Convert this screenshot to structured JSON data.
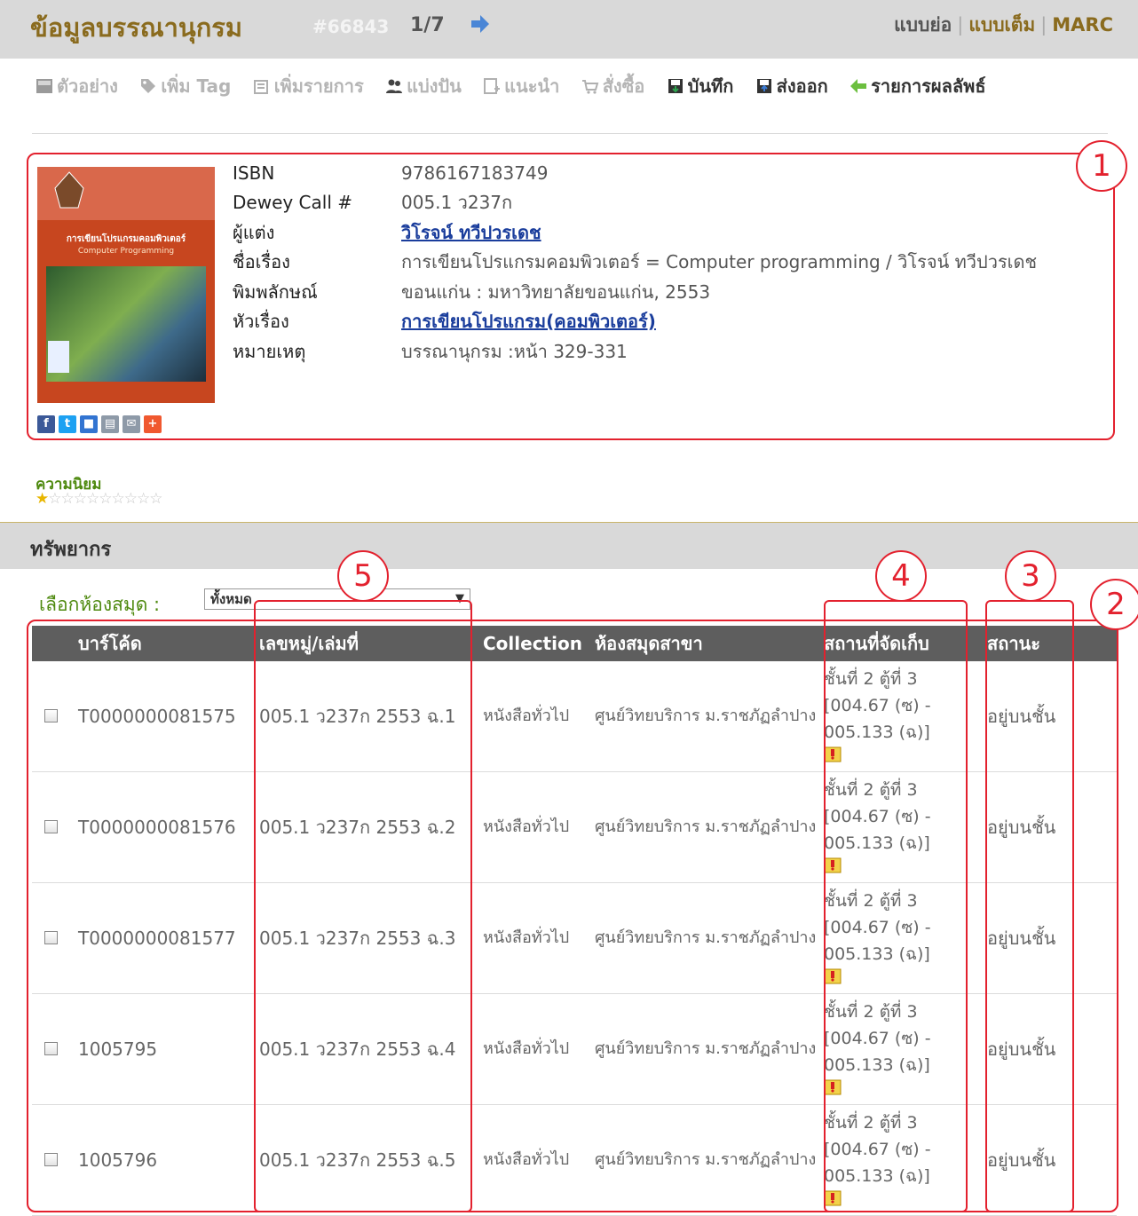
{
  "header": {
    "title": "ข้อมูลบรรณานุกรม",
    "record_id": "#66843",
    "pager": "1/7",
    "views": [
      "แบบย่อ",
      "แบบเต็ม",
      "MARC"
    ]
  },
  "toolbar": {
    "items": [
      {
        "label": "ตัวอย่าง",
        "icon": "preview-icon",
        "enabled": false
      },
      {
        "label": "เพิ่ม Tag",
        "icon": "tag-icon",
        "enabled": false
      },
      {
        "label": "เพิ่มรายการ",
        "icon": "add-list-icon",
        "enabled": false
      },
      {
        "label": "แบ่งปัน",
        "icon": "share-people-icon",
        "enabled": false
      },
      {
        "label": "แนะนำ",
        "icon": "recommend-icon",
        "enabled": false
      },
      {
        "label": "สั่งซื้อ",
        "icon": "cart-icon",
        "enabled": false
      },
      {
        "label": "บันทึก",
        "icon": "save-icon",
        "enabled": true
      },
      {
        "label": "ส่งออก",
        "icon": "export-icon",
        "enabled": true
      },
      {
        "label": "รายการผลลัพธ์",
        "icon": "back-arrow-icon",
        "enabled": true
      }
    ]
  },
  "record": {
    "fields": [
      {
        "label": "ISBN",
        "value": "9786167183749",
        "link": false
      },
      {
        "label": "Dewey Call #",
        "value": "005.1 ว237ก",
        "link": false
      },
      {
        "label": "ผู้แต่ง",
        "value": "วิโรจน์ ทวีปวรเดช",
        "link": true
      },
      {
        "label": "ชื่อเรื่อง",
        "value": "การเขียนโปรแกรมคอมพิวเตอร์ = Computer programming / วิโรจน์ ทวีปวรเดช",
        "link": false
      },
      {
        "label": "พิมพลักษณ์",
        "value": "ขอนแก่น : มหาวิทยาลัยขอนแก่น, 2553",
        "link": false
      },
      {
        "label": "หัวเรื่อง",
        "value": "การเขียนโปรแกรม(คอมพิวเตอร์)",
        "link": true
      },
      {
        "label": "หมายเหตุ",
        "value": "บรรณานุกรม :หน้า 329-331",
        "link": false
      }
    ],
    "cover_title_th": "การเขียนโปรแกรมคอมพิวเตอร์",
    "cover_title_en": "Computer Programming",
    "share_icons": [
      {
        "name": "facebook-icon",
        "glyph": "f",
        "color": "#3b5998"
      },
      {
        "name": "twitter-icon",
        "glyph": "t",
        "color": "#1da1f2"
      },
      {
        "name": "delicious-icon",
        "glyph": "■",
        "color": "#3274d1"
      },
      {
        "name": "print-icon",
        "glyph": "▤",
        "color": "#8e9aa8"
      },
      {
        "name": "email-icon",
        "glyph": "✉",
        "color": "#8e9aa8"
      },
      {
        "name": "more-share-icon",
        "glyph": "+",
        "color": "#f0582f"
      }
    ]
  },
  "popularity": {
    "label": "ความนิยม",
    "rating": 1,
    "max": 10
  },
  "resources": {
    "title": "ทรัพยากร",
    "library_label": "เลือกห้องสมุด :",
    "library_selected": "ทั้งหมด",
    "columns": [
      "บาร์โค้ด",
      "เลขหมู่/เล่มที่",
      "Collection",
      "ห้องสมุดสาขา",
      "สถานที่จัดเก็บ",
      "สถานะ"
    ],
    "rows": [
      {
        "barcode": "T0000000081575",
        "call_no": "005.1 ว237ก 2553 ฉ.1",
        "collection": "หนังสือทั่วไป",
        "branch": "ศูนย์วิทยบริการ ม.ราชภัฏลำปาง",
        "location": [
          "ชั้นที่ 2 ตู้ที่ 3",
          "[004.67 (ซ) -",
          "005.133 (ฉ)]"
        ],
        "status": "อยู่บนชั้น"
      },
      {
        "barcode": "T0000000081576",
        "call_no": "005.1 ว237ก 2553 ฉ.2",
        "collection": "หนังสือทั่วไป",
        "branch": "ศูนย์วิทยบริการ ม.ราชภัฏลำปาง",
        "location": [
          "ชั้นที่ 2 ตู้ที่ 3",
          "[004.67 (ซ) -",
          "005.133 (ฉ)]"
        ],
        "status": "อยู่บนชั้น"
      },
      {
        "barcode": "T0000000081577",
        "call_no": "005.1 ว237ก 2553 ฉ.3",
        "collection": "หนังสือทั่วไป",
        "branch": "ศูนย์วิทยบริการ ม.ราชภัฏลำปาง",
        "location": [
          "ชั้นที่ 2 ตู้ที่ 3",
          "[004.67 (ซ) -",
          "005.133 (ฉ)]"
        ],
        "status": "อยู่บนชั้น"
      },
      {
        "barcode": "1005795",
        "call_no": "005.1 ว237ก 2553 ฉ.4",
        "collection": "หนังสือทั่วไป",
        "branch": "ศูนย์วิทยบริการ ม.ราชภัฏลำปาง",
        "location": [
          "ชั้นที่ 2 ตู้ที่ 3",
          "[004.67 (ซ) -",
          "005.133 (ฉ)]"
        ],
        "status": "อยู่บนชั้น"
      },
      {
        "barcode": "1005796",
        "call_no": "005.1 ว237ก 2553 ฉ.5",
        "collection": "หนังสือทั่วไป",
        "branch": "ศูนย์วิทยบริการ ม.ราชภัฏลำปาง",
        "location": [
          "ชั้นที่ 2 ตู้ที่ 3",
          "[004.67 (ซ) -",
          "005.133 (ฉ)]"
        ],
        "status": "อยู่บนชั้น"
      }
    ]
  },
  "annotations": [
    "1",
    "2",
    "3",
    "4",
    "5"
  ],
  "colors": {
    "accent": "#8a6b1e",
    "link": "#1a3d9c",
    "annotation": "#e3212e",
    "green": "#4f8a10"
  }
}
